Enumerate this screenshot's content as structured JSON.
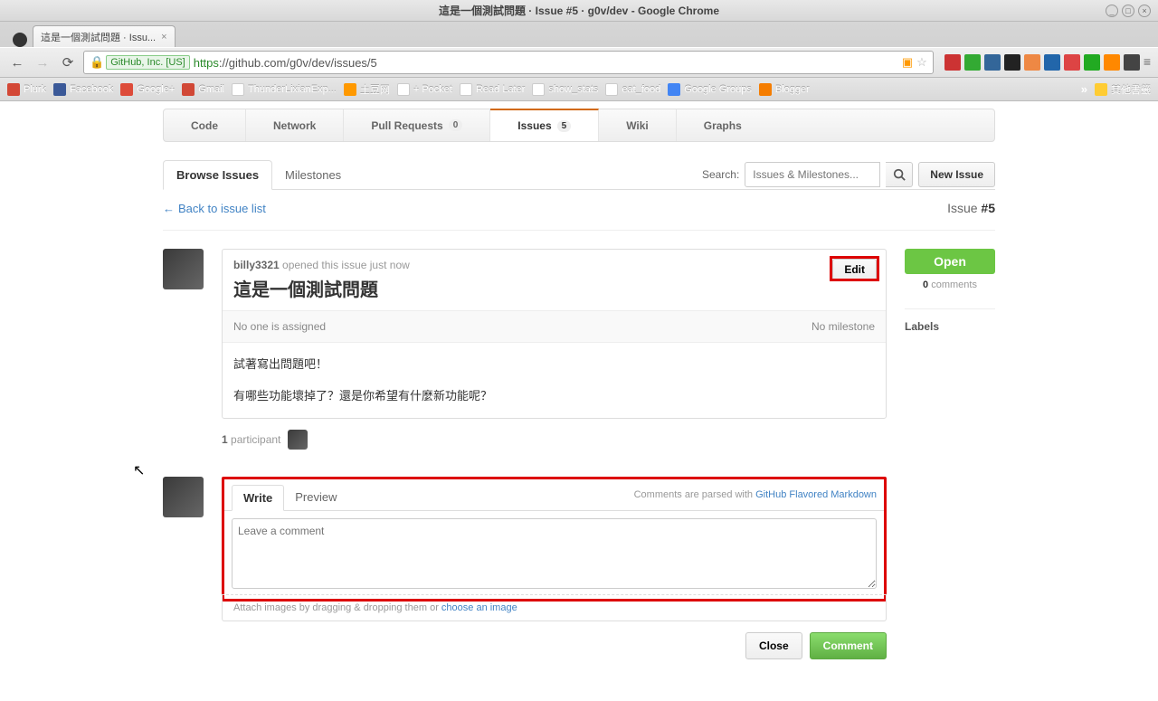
{
  "window": {
    "title": "這是一個測試問題 ·  Issue #5 ·  g0v/dev - Google Chrome"
  },
  "browser": {
    "tab_title": "這是一個測試問題 ·  Issu...",
    "url_identity": "GitHub, Inc. [US]",
    "url_protocol": "https",
    "url_rest": "://github.com/g0v/dev/issues/5"
  },
  "bookmarks": {
    "items": [
      {
        "label": "Plurk",
        "color": "#d34836"
      },
      {
        "label": "Facebook",
        "color": "#3b5998"
      },
      {
        "label": "Google+",
        "color": "#dd4b39"
      },
      {
        "label": "Gmail",
        "color": "#d14836"
      },
      {
        "label": "ThunderLixianExp...",
        "color": "#fff"
      },
      {
        "label": "土豆网",
        "color": "#f90"
      },
      {
        "label": "+ Pocket",
        "color": "#fff"
      },
      {
        "label": "Read Later",
        "color": "#fff"
      },
      {
        "label": "show_stats",
        "color": "#fff"
      },
      {
        "label": "eat_food",
        "color": "#fff"
      },
      {
        "label": "Google Groups",
        "color": "#4285f4"
      },
      {
        "label": "Blogger",
        "color": "#f57d00"
      }
    ],
    "overflow": "»",
    "other": "其他書籤"
  },
  "repo_nav": {
    "code": "Code",
    "network": "Network",
    "pulls": "Pull Requests",
    "pulls_count": "0",
    "issues": "Issues",
    "issues_count": "5",
    "wiki": "Wiki",
    "graphs": "Graphs"
  },
  "toolbar": {
    "browse": "Browse Issues",
    "milestones": "Milestones",
    "search_label": "Search:",
    "search_placeholder": "Issues & Milestones...",
    "new_issue": "New Issue"
  },
  "backrow": {
    "back": "Back to issue list",
    "issue_label": "Issue ",
    "issue_num": "#5"
  },
  "issue": {
    "author": "billy3321",
    "opened": " opened this issue just now",
    "title": "這是一個測試問題",
    "edit": "Edit",
    "assignee": "No one is assigned",
    "milestone": "No milestone",
    "body_line1": "試著寫出問題吧！",
    "body_line2": "有哪些功能壞掉了？還是你希望有什麼新功能呢？"
  },
  "participants": {
    "count": "1",
    "label": " participant"
  },
  "sidebar": {
    "state": "Open",
    "comments_n": "0",
    "comments_label": " comments",
    "labels_hdr": "Labels"
  },
  "comment": {
    "write": "Write",
    "preview": "Preview",
    "hint_prefix": "Comments are parsed with ",
    "hint_link": "GitHub Flavored Markdown",
    "placeholder": "Leave a comment",
    "attach_prefix": "Attach images by dragging & dropping them or ",
    "attach_link": "choose an image",
    "close": "Close",
    "comment_btn": "Comment"
  }
}
